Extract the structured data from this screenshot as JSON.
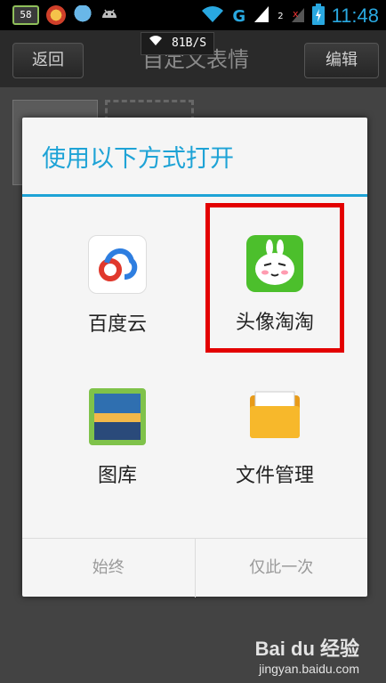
{
  "status_bar": {
    "battery_level": "58",
    "network_type": "G",
    "sim_label": "2",
    "time": "11:48"
  },
  "netspeed": "81B/S",
  "titlebar": {
    "back_label": "返回",
    "title": "自定义表情",
    "edit_label": "编辑"
  },
  "dialog": {
    "title": "使用以下方式打开",
    "apps": [
      {
        "label": "百度云",
        "icon": "baidu-cloud-icon"
      },
      {
        "label": "头像淘淘",
        "icon": "rabbit-app-icon"
      },
      {
        "label": "图库",
        "icon": "gallery-icon"
      },
      {
        "label": "文件管理",
        "icon": "file-manager-icon"
      }
    ],
    "always_label": "始终",
    "once_label": "仅此一次"
  },
  "watermark": {
    "brand": "Bai du 经验",
    "url": "jingyan.baidu.com"
  },
  "colors": {
    "accent": "#1ea3d6",
    "highlight": "#e30000",
    "clock": "#29a8e0"
  }
}
